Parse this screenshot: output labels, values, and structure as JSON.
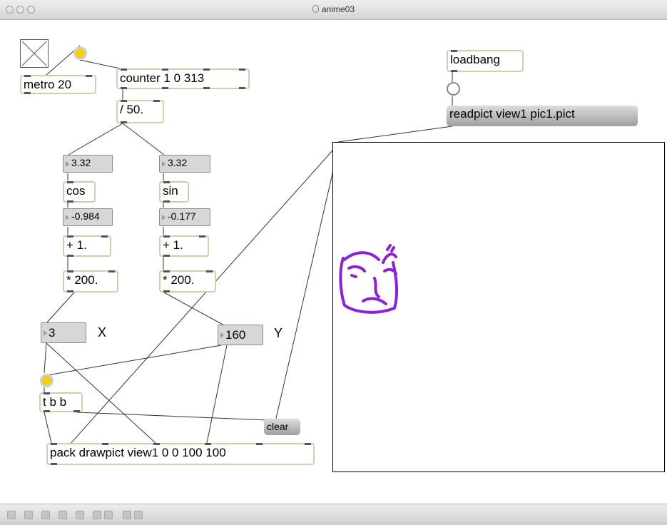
{
  "window": {
    "title": "anime03"
  },
  "patch": {
    "metro": "metro 20",
    "counter": "counter 1 0 313",
    "divide": "/ 50.",
    "loadbang": "loadbang",
    "readpict": "readpict view1 pic1.pict",
    "num_angle_left": "3.32",
    "num_angle_right": "3.32",
    "cos": "cos",
    "sin": "sin",
    "num_cos": "-0.984",
    "num_sin": "-0.177",
    "add_left": "+ 1.",
    "add_right": "+ 1.",
    "mul_left": "* 200.",
    "mul_right": "* 200.",
    "num_x": "3",
    "label_x": "X",
    "num_y": "160",
    "label_y": "Y",
    "trigger": "t b b",
    "clear": "clear",
    "pack": "pack drawpict view1 0 0 100 100"
  },
  "colors": {
    "bang_active": "#f2cf12",
    "face_stroke": "#8b22d6"
  },
  "toolbar": {
    "icons": [
      "lock-icon",
      "add-icon",
      "move-icon",
      "inspector-icon",
      "info-icon",
      "window-icon",
      "window-alt-icon",
      "grid-icon",
      "snap-icon"
    ]
  }
}
